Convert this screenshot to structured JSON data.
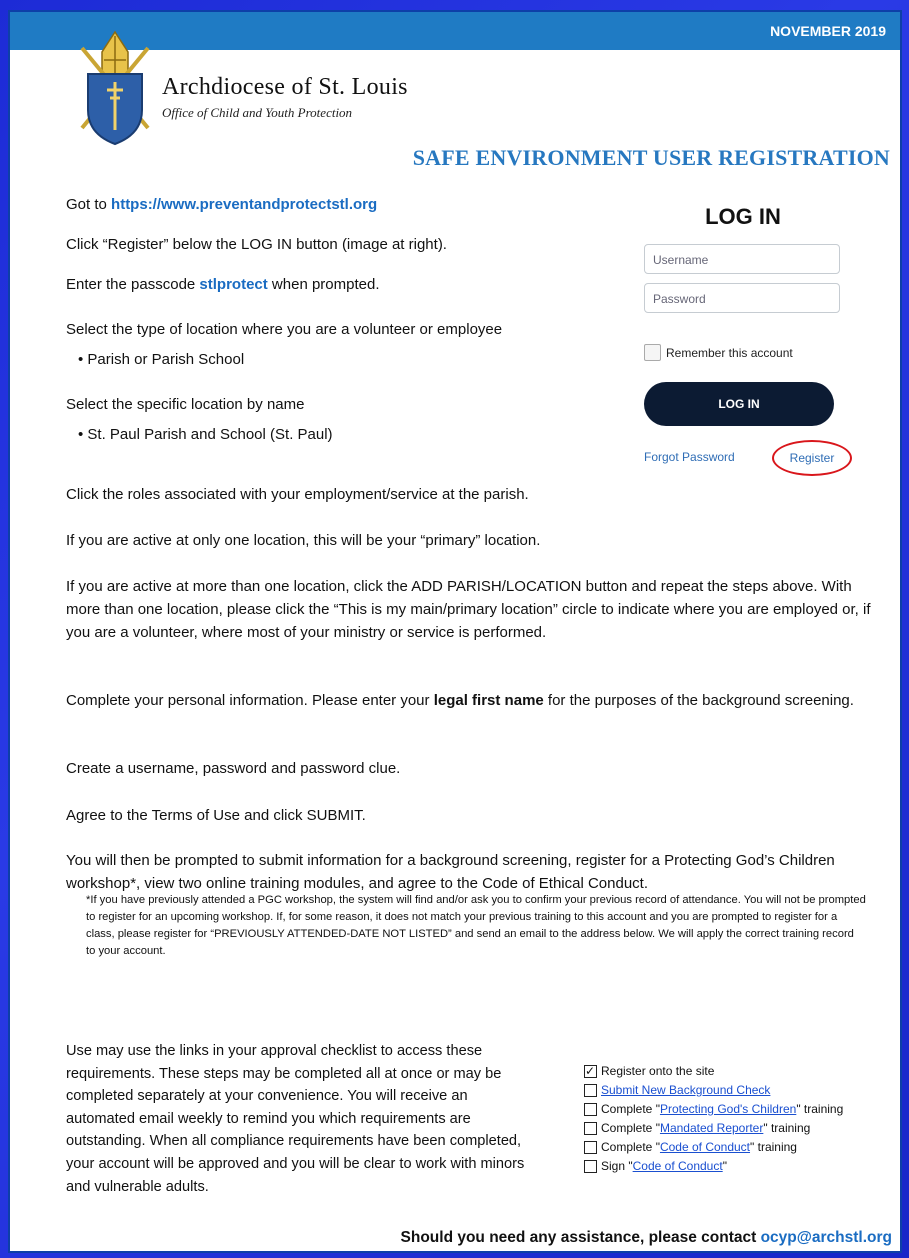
{
  "header": {
    "date": "NOVEMBER 2019"
  },
  "org": {
    "name": "Archdiocese of St. Louis",
    "office": "Office of Child and Youth Protection"
  },
  "title": "SAFE ENVIRONMENT USER REGISTRATION",
  "steps": {
    "s1_prefix": "Got to ",
    "s1_url": "https://www.preventandprotectstl.org",
    "s2": "Click “Register” below the LOG IN button (image at right).",
    "s3_prefix": "Enter the passcode ",
    "s3_code": "stlprotect",
    "s3_suffix": " when prompted.",
    "s4": "Select the type of location where you are a volunteer or employee",
    "s4_bullet": "• Parish or Parish School",
    "s5": "Select the specific location by name",
    "s5_bullet": "• St. Paul Parish and School (St. Paul)"
  },
  "body": {
    "roles": "Click the roles associated with your employment/service at the parish.",
    "one_location": "If you are active at only one location, this will be your “primary” location.",
    "multi_location": "If you are active at more than one location, click the ADD PARISH/LOCATION button and repeat the steps above.  With more than one location, please click the “This is my main/primary location” circle to indicate where you are employed or, if you are a volunteer, where most of your ministry or service is performed.",
    "personal_prefix": "Complete your personal information.  Please enter your ",
    "personal_bold": "legal first name",
    "personal_suffix": " for the purposes of the background screening.",
    "username": "Create a username, password and password clue.",
    "terms": "Agree to the Terms of Use and click SUBMIT.",
    "prompted": "You will then be prompted to submit information for a background screening, register for a Protecting God’s Children workshop*, view two online training modules, and agree to the Code of Ethical Conduct."
  },
  "note": "*If you have previously attended a PGC workshop, the system will find and/or ask you to confirm your previous record of attendance.  You will not be prompted to register for an upcoming workshop.  If, for some reason, it does not match your previous training to this account and you are prompted to register for a class, please register for “PREVIOUSLY ATTENDED-DATE NOT LISTED” and send an email to the address below.  We will apply the correct training record to your account.",
  "closing": "Use may use the links in your approval checklist to access these requirements.  These steps may be completed all at once or may be completed separately at your convenience.  You will receive an automated email weekly to remind you which requirements are outstanding.  When all compliance requirements have been completed, your account will be approved and you will be clear to work with minors and vulnerable adults.",
  "checklist": {
    "i1": "Register onto the site",
    "i2": "Submit New Background Check",
    "i3_pre": "Complete \"",
    "i3_link": "Protecting God's Children",
    "i3_post": "\" training",
    "i4_pre": "Complete \"",
    "i4_link": "Mandated Reporter",
    "i4_post": "\" training",
    "i5_pre": "Complete \"",
    "i5_link": "Code of Conduct",
    "i5_post": "\" training",
    "i6_pre": "Sign \"",
    "i6_link": "Code of Conduct",
    "i6_post": "\""
  },
  "login": {
    "title": "LOG IN",
    "username_placeholder": "Username",
    "password_placeholder": "Password",
    "remember": "Remember this account",
    "button": "LOG IN",
    "forgot": "Forgot Password",
    "register": "Register"
  },
  "footer": {
    "text": "Should you need any assistance, please contact ",
    "email": "ocyp@archstl.org"
  }
}
